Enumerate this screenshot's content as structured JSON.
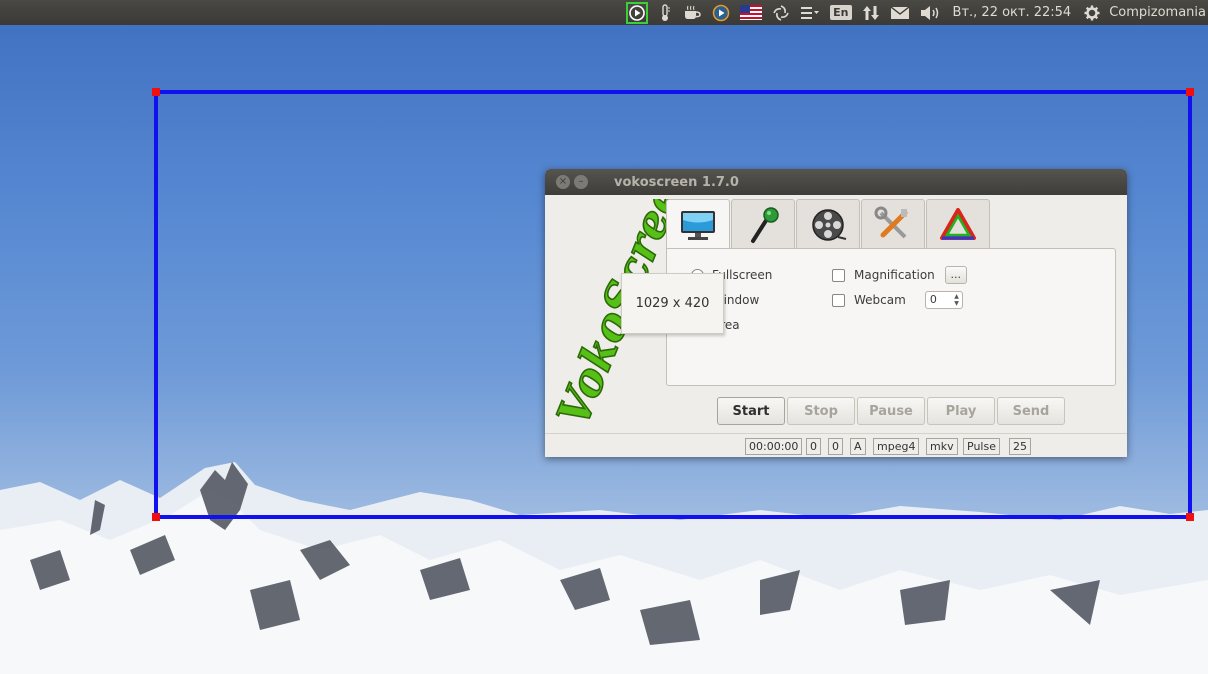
{
  "top_panel": {
    "indicators": [
      "record-indicator-icon",
      "thermometer-icon",
      "coffee-cup-icon",
      "media-player-icon",
      "us-flag-icon",
      "shutter-icon",
      "menu-list-icon",
      "keyboard-layout",
      "network-arrows-icon",
      "mail-icon",
      "volume-icon"
    ],
    "keyboard_layout": "En",
    "clock": "Вт., 22 окт. 22:54",
    "user": "Compizomania"
  },
  "selection_overlay": {
    "size_label": "1029 x 420",
    "border_color": "#1010f0",
    "corner_color": "#f01010"
  },
  "window": {
    "title": "vokoscreen 1.7.0",
    "logo_text": "VokoScreen",
    "tabs": [
      "monitor-icon",
      "microphone-icon",
      "film-reel-icon",
      "tools-icon",
      "triangle-icon"
    ],
    "screen_tab": {
      "radio_fullscreen": "Fullscreen",
      "radio_window": "Window",
      "radio_area": "Area",
      "magnification_label": "Magnification",
      "magnification_button": "...",
      "webcam_label": "Webcam",
      "webcam_value": "0"
    },
    "buttons": {
      "start": "Start",
      "stop": "Stop",
      "pause": "Pause",
      "play": "Play",
      "send": "Send"
    },
    "status": {
      "time": "00:00:00",
      "frames": "0",
      "fps_count": "0",
      "audio_flag": "A",
      "codec": "mpeg4",
      "container": "mkv",
      "audio_system": "Pulse",
      "fps": "25"
    }
  }
}
